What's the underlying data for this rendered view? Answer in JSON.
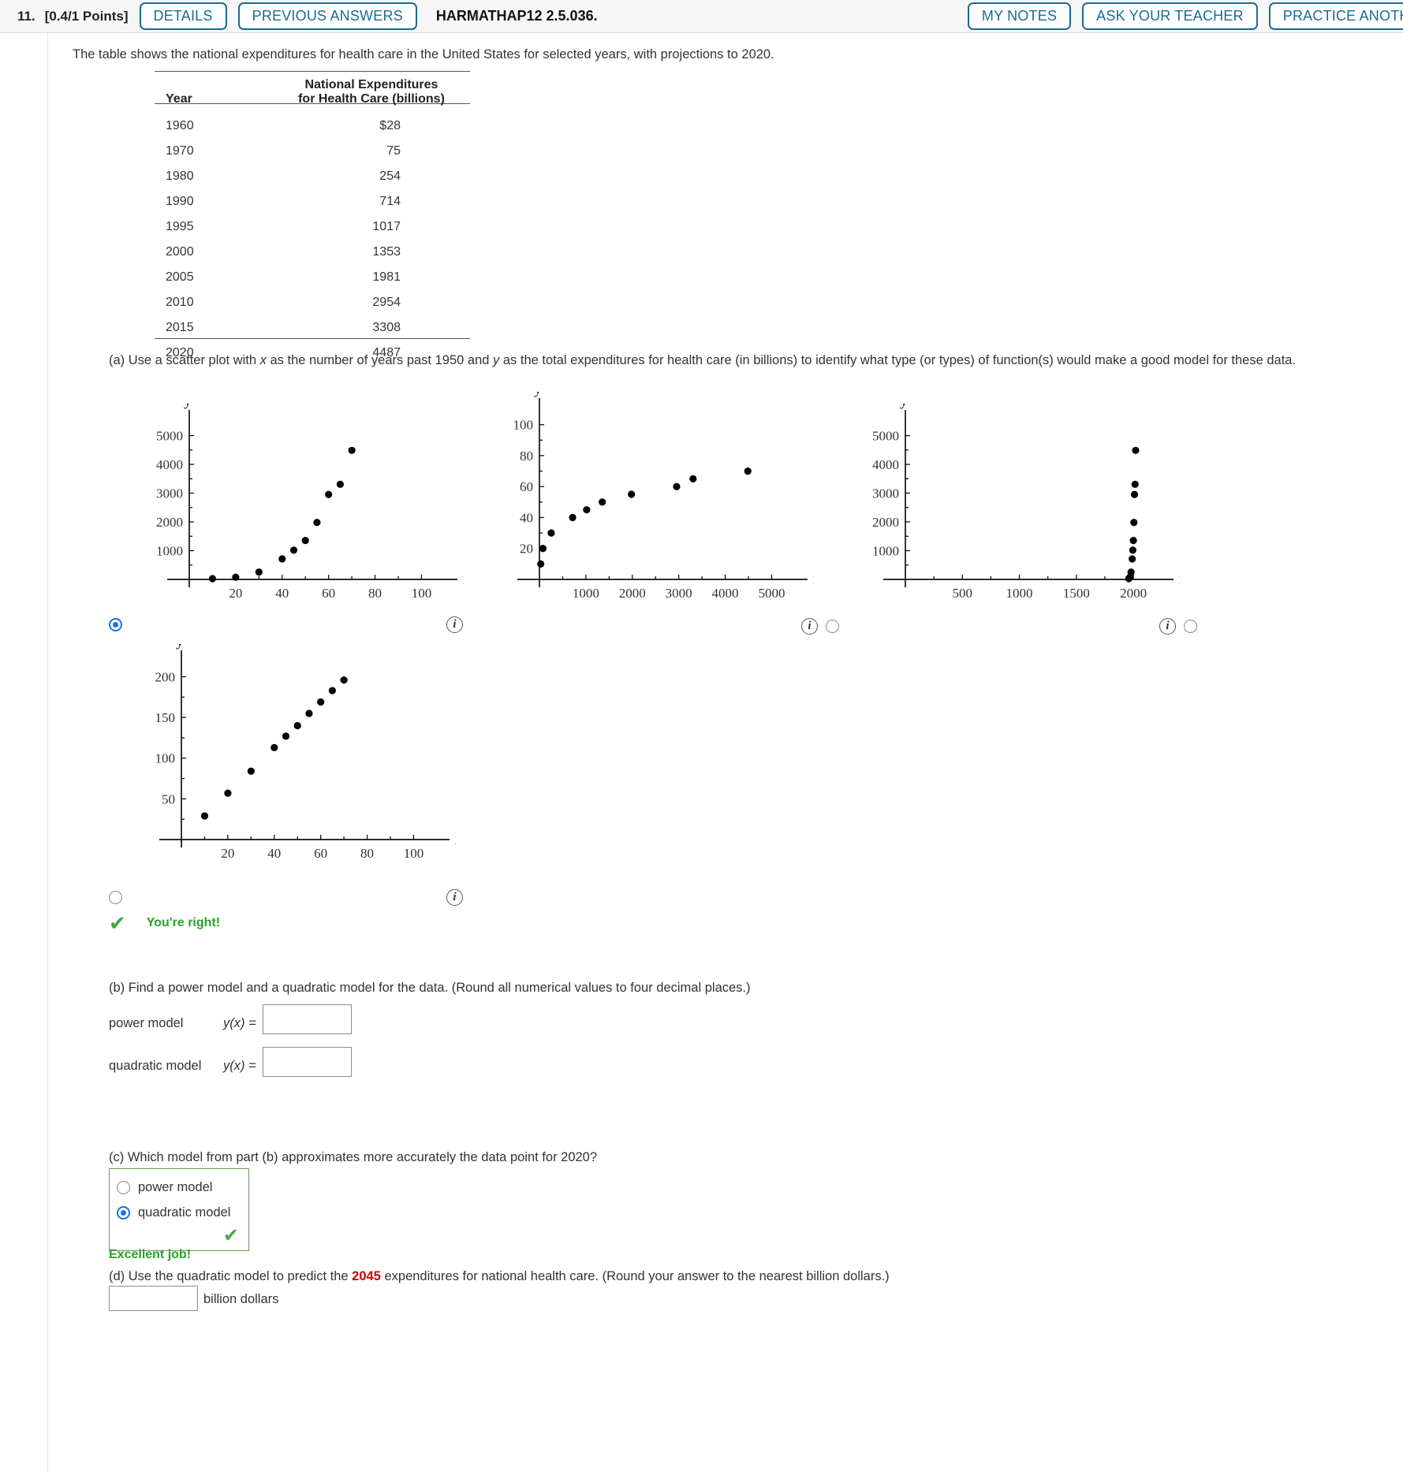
{
  "header": {
    "question_number": "11.",
    "points": "[0.4/1 Points]",
    "buttons": [
      {
        "label": "DETAILS",
        "name": "details-button"
      },
      {
        "label": "PREVIOUS ANSWERS",
        "name": "previous-answers-button"
      }
    ],
    "assignment_code": "HARMATHAP12 2.5.036.",
    "right_buttons": [
      {
        "label": "MY NOTES",
        "name": "my-notes-button"
      },
      {
        "label": "ASK YOUR TEACHER",
        "name": "ask-your-teacher-button"
      },
      {
        "label": "PRACTICE ANOTHER",
        "name": "practice-another-button"
      }
    ]
  },
  "intro": "The table shows the national expenditures for health care in the United States for selected years, with projections to 2020.",
  "table": {
    "headers": [
      "Year",
      "National Expenditures\nfor Health Care (billions)"
    ],
    "header_year": "Year",
    "header_exp_line1": "National Expenditures",
    "header_exp_line2": "for Health Care (billions)",
    "rows": [
      {
        "year": "1960",
        "expenditure": "$28"
      },
      {
        "year": "1970",
        "expenditure": "75"
      },
      {
        "year": "1980",
        "expenditure": "254"
      },
      {
        "year": "1990",
        "expenditure": "714"
      },
      {
        "year": "1995",
        "expenditure": "1017"
      },
      {
        "year": "2000",
        "expenditure": "1353"
      },
      {
        "year": "2005",
        "expenditure": "1981"
      },
      {
        "year": "2010",
        "expenditure": "2954"
      },
      {
        "year": "2015",
        "expenditure": "3308"
      },
      {
        "year": "2020",
        "expenditure": "4487"
      }
    ]
  },
  "part_a": {
    "text_before_x": "(a) Use a scatter plot with ",
    "x_var": "x",
    "text_mid": " as the number of years past 1950 and ",
    "y_var": "y",
    "text_after": " as the total expenditures for health care (in billions) to identify what type (or types) of function(s) would make a good model for these data.",
    "feedback": "You're right!",
    "feedback_icon": "check-icon",
    "info_icon_label": "i"
  },
  "chart_data": [
    {
      "id": "plot-1",
      "type": "scatter",
      "selected": true,
      "xlabel": "x",
      "ylabel": "y",
      "xticks": [
        20,
        40,
        60,
        80,
        100
      ],
      "yticks": [
        1000,
        2000,
        3000,
        4000,
        5000
      ],
      "xlim": [
        0,
        108
      ],
      "ylim": [
        0,
        5400
      ],
      "x": [
        10,
        20,
        30,
        40,
        45,
        50,
        55,
        60,
        65,
        70
      ],
      "y": [
        28,
        75,
        254,
        714,
        1017,
        1353,
        1981,
        2954,
        3308,
        4487
      ]
    },
    {
      "id": "plot-2",
      "type": "scatter",
      "selected": false,
      "xlabel": "x",
      "ylabel": "y",
      "xticks": [
        1000,
        2000,
        3000,
        4000,
        5000
      ],
      "yticks": [
        20,
        40,
        60,
        80,
        100
      ],
      "xlim": [
        0,
        5400
      ],
      "ylim": [
        0,
        108
      ],
      "x": [
        28,
        75,
        254,
        714,
        1017,
        1353,
        1981,
        2954,
        3308,
        4487
      ],
      "y": [
        10,
        20,
        30,
        40,
        45,
        50,
        55,
        60,
        65,
        70
      ]
    },
    {
      "id": "plot-3",
      "type": "scatter",
      "selected": false,
      "xlabel": "x",
      "ylabel": "y",
      "xticks": [
        500,
        1000,
        1500,
        2000
      ],
      "yticks": [
        1000,
        2000,
        3000,
        4000,
        5000
      ],
      "xlim": [
        0,
        2200
      ],
      "ylim": [
        0,
        5400
      ],
      "x": [
        1960,
        1970,
        1980,
        1990,
        1995,
        2000,
        2005,
        2010,
        2015,
        2020
      ],
      "y": [
        28,
        75,
        254,
        714,
        1017,
        1353,
        1981,
        2954,
        3308,
        4487
      ]
    },
    {
      "id": "plot-4",
      "type": "scatter",
      "selected": false,
      "xlabel": "x",
      "ylabel": "y",
      "xticks": [
        20,
        40,
        60,
        80,
        100
      ],
      "yticks": [
        50,
        100,
        150,
        200
      ],
      "xlim": [
        0,
        108
      ],
      "ylim": [
        0,
        215
      ],
      "x": [
        10,
        20,
        30,
        40,
        45,
        50,
        55,
        60,
        65,
        70
      ],
      "y": [
        29,
        57,
        84,
        113,
        127,
        140,
        155,
        169,
        183,
        196
      ]
    }
  ],
  "part_b": {
    "text": "(b) Find a power model and a quadratic model for the data. (Round all numerical values to four decimal places.)",
    "power_label": "power model",
    "power_eq": "y(x) =",
    "power_value": "",
    "quadratic_label": "quadratic model",
    "quadratic_eq": "y(x) =",
    "quadratic_value": ""
  },
  "part_c": {
    "text": "(c) Which model from part (b) approximates more accurately the data point for 2020?",
    "options": [
      {
        "label": "power model",
        "selected": false
      },
      {
        "label": "quadratic model",
        "selected": true
      }
    ],
    "feedback": "Excellent job!",
    "check_icon": "check-icon"
  },
  "part_d": {
    "text_before": "(d) Use the quadratic model to predict the ",
    "highlight_year": "2045",
    "text_after": " expenditures for national health care. (Round your answer to the nearest billion dollars.)",
    "answer_value": "",
    "unit": "billion dollars"
  },
  "colors": {
    "link_blue": "#1a6a96",
    "radio_blue": "#1573e6",
    "success_green": "#2aa02a",
    "highlight_red": "#cc0000"
  }
}
